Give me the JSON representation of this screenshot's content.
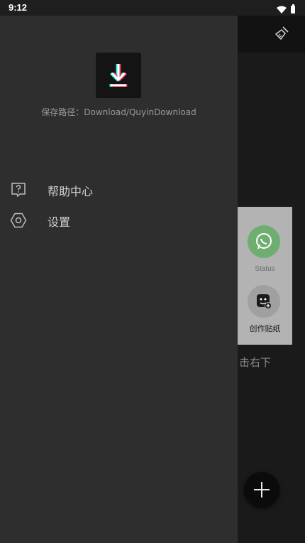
{
  "status_bar": {
    "time": "9:12",
    "icons": [
      "wifi-icon",
      "battery-icon"
    ]
  },
  "drawer": {
    "logo_icon": "download-icon",
    "save_path": "保存路径：Download/QuyinDownload",
    "menu": [
      {
        "label": "帮助中心",
        "icon": "help-icon"
      },
      {
        "label": "设置",
        "icon": "settings-icon"
      }
    ]
  },
  "app": {
    "toolbar_icon": "clean-broom-icon",
    "share_sheet": {
      "items": [
        {
          "label": "Status",
          "icon": "whatsapp-icon"
        },
        {
          "label": "创作贴纸",
          "icon": "sticker-icon"
        }
      ]
    },
    "hint_text": "击右下",
    "fab_icon": "plus-icon"
  },
  "colors": {
    "drawer_bg": "#2e2e2e",
    "app_bg": "#1a1a1a",
    "toolbar_bg": "#121212",
    "whatsapp_green": "#6fae71",
    "logo_accent_cyan": "#25f4ee",
    "logo_accent_red": "#fe2c55"
  }
}
